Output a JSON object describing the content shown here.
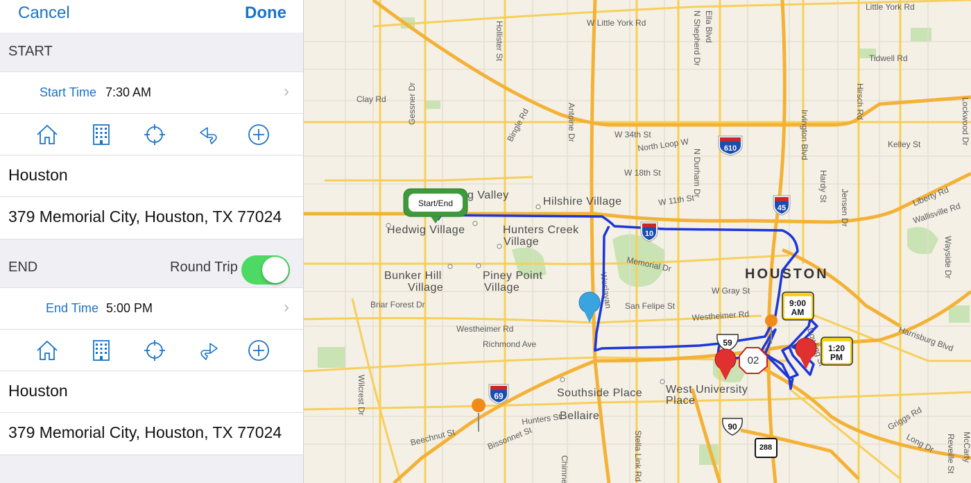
{
  "nav": {
    "cancel_label": "Cancel",
    "done_label": "Done"
  },
  "start": {
    "header": "START",
    "time_label": "Start Time",
    "time_value": "7:30 AM",
    "city": "Houston",
    "address": "379 Memorial City, Houston, TX 77024",
    "icons": [
      "home-icon",
      "building-icon",
      "crosshair-icon",
      "return-arrow-icon",
      "add-icon"
    ]
  },
  "end": {
    "header": "END",
    "round_trip_label": "Round Trip",
    "round_trip_on": true,
    "time_label": "End Time",
    "time_value": "5:00 PM",
    "city": "Houston",
    "address": "379 Memorial City, Houston, TX 77024",
    "icons": [
      "home-icon",
      "building-icon",
      "crosshair-icon",
      "forward-arrow-icon",
      "add-icon"
    ]
  },
  "map": {
    "city_label": "HOUSTON",
    "callouts": {
      "start_end": "Start/End",
      "stop1_time": "9:00 AM",
      "stop2_time": "1:20 PM",
      "stop_number": "02"
    },
    "shields": {
      "i610": "610",
      "i10": "10",
      "i45": "45",
      "i69": "69",
      "us59": "59",
      "us90": "90",
      "sh288": "288"
    },
    "place_labels": {
      "spring_valley": "g Valley",
      "hilshire_village": "Hilshire Village",
      "hedwig_village": "Hedwig Village",
      "hunters_creek_1": "Hunters Creek",
      "hunters_creek_2": "Village",
      "bunker_hill_1": "Bunker Hill",
      "bunker_hill_2": "Village",
      "piney_point_1": "Piney Point",
      "piney_point_2": "Village",
      "southside_place": "Southside Place",
      "west_university_1": "West University",
      "west_university_2": "Place",
      "bellaire": "Bellaire"
    },
    "street_labels": {
      "w_little_york": "W Little York Rd",
      "little_york": "Little York Rd",
      "tidwell": "Tidwell Rd",
      "clay": "Clay Rd",
      "hirsch": "Hirsch Rd",
      "kelley": "Kelley St",
      "w_34th": "W 34th St",
      "north_loop": "North Loop W",
      "w_18th": "W 18th St",
      "w_11th": "W 11th St",
      "liberty": "Liberty Rd",
      "wallisville": "Wallisville Rd",
      "memorial_dr": "Memorial Dr",
      "w_gray": "W Gray St",
      "san_felipe": "San Felipe St",
      "westheimer_1": "Westheimer Rd",
      "westheimer_2": "Westheimer Rd",
      "richmond": "Richmond Ave",
      "briar_forest": "Briar Forest Dr",
      "beechnut": "Beechnut St",
      "bissonnet": "Bissonnet St",
      "hunters_st": "Hunters St",
      "harrisburg": "Harrisburg Blvd",
      "griggs": "Griggs Rd",
      "long_dr": "Long Dr",
      "hollister": "Hollister St",
      "gessner": "Gessner Dr",
      "bingle": "Bingle Rd",
      "antoine": "Antoine Dr",
      "ella": "Ella Blvd",
      "shepherd": "N Shepherd Dr",
      "durham": "N Durham Dr",
      "irvington": "Irvington Blvd",
      "hardy": "Hardy St",
      "jensen": "Jensen Dr",
      "lockwood": "Lockwood Dr",
      "wayside": "Wayside Dr",
      "wilcrest": "Wilcrest Dr",
      "westpark": "Weslayan",
      "dowling": "Dowling St",
      "stella_link": "Stella Link Rd",
      "chimney": "Chimney",
      "reveille": "Reveille St",
      "mccarty": "McCarty"
    }
  }
}
